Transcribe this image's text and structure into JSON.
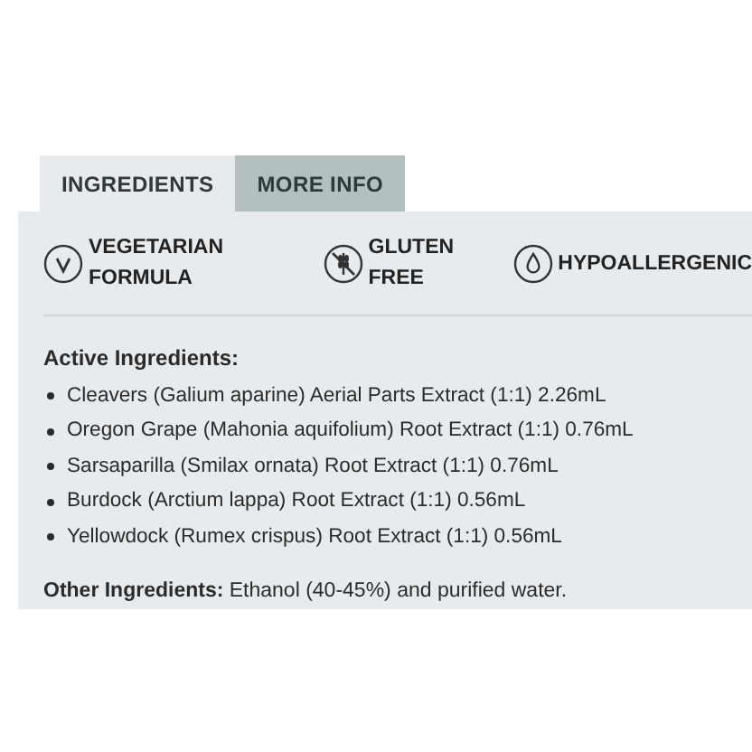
{
  "tabs": [
    {
      "label": "INGREDIENTS",
      "selected": true
    },
    {
      "label": "MORE INFO",
      "selected": false
    }
  ],
  "features": [
    {
      "kind": "vegetarian",
      "label": "VEGETARIAN FORMULA"
    },
    {
      "kind": "gluten",
      "label": "GLUTEN FREE"
    },
    {
      "kind": "hypoallergenic",
      "label": "HYPOALLERGENIC"
    }
  ],
  "active_heading": "Active Ingredients:",
  "active_ingredients": [
    "Cleavers (Galium aparine) Aerial Parts Extract (1:1) 2.26mL",
    "Oregon Grape (Mahonia aquifolium) Root Extract (1:1) 0.76mL",
    "Sarsaparilla (Smilax ornata) Root Extract (1:1) 0.76mL",
    "Burdock (Arctium lappa) Root Extract (1:1) 0.56mL",
    "Yellowdock (Rumex crispus) Root Extract (1:1) 0.56mL"
  ],
  "other_ingredients": "**Other Ingredients:** Ethanol (40-45%) and purified water."
}
